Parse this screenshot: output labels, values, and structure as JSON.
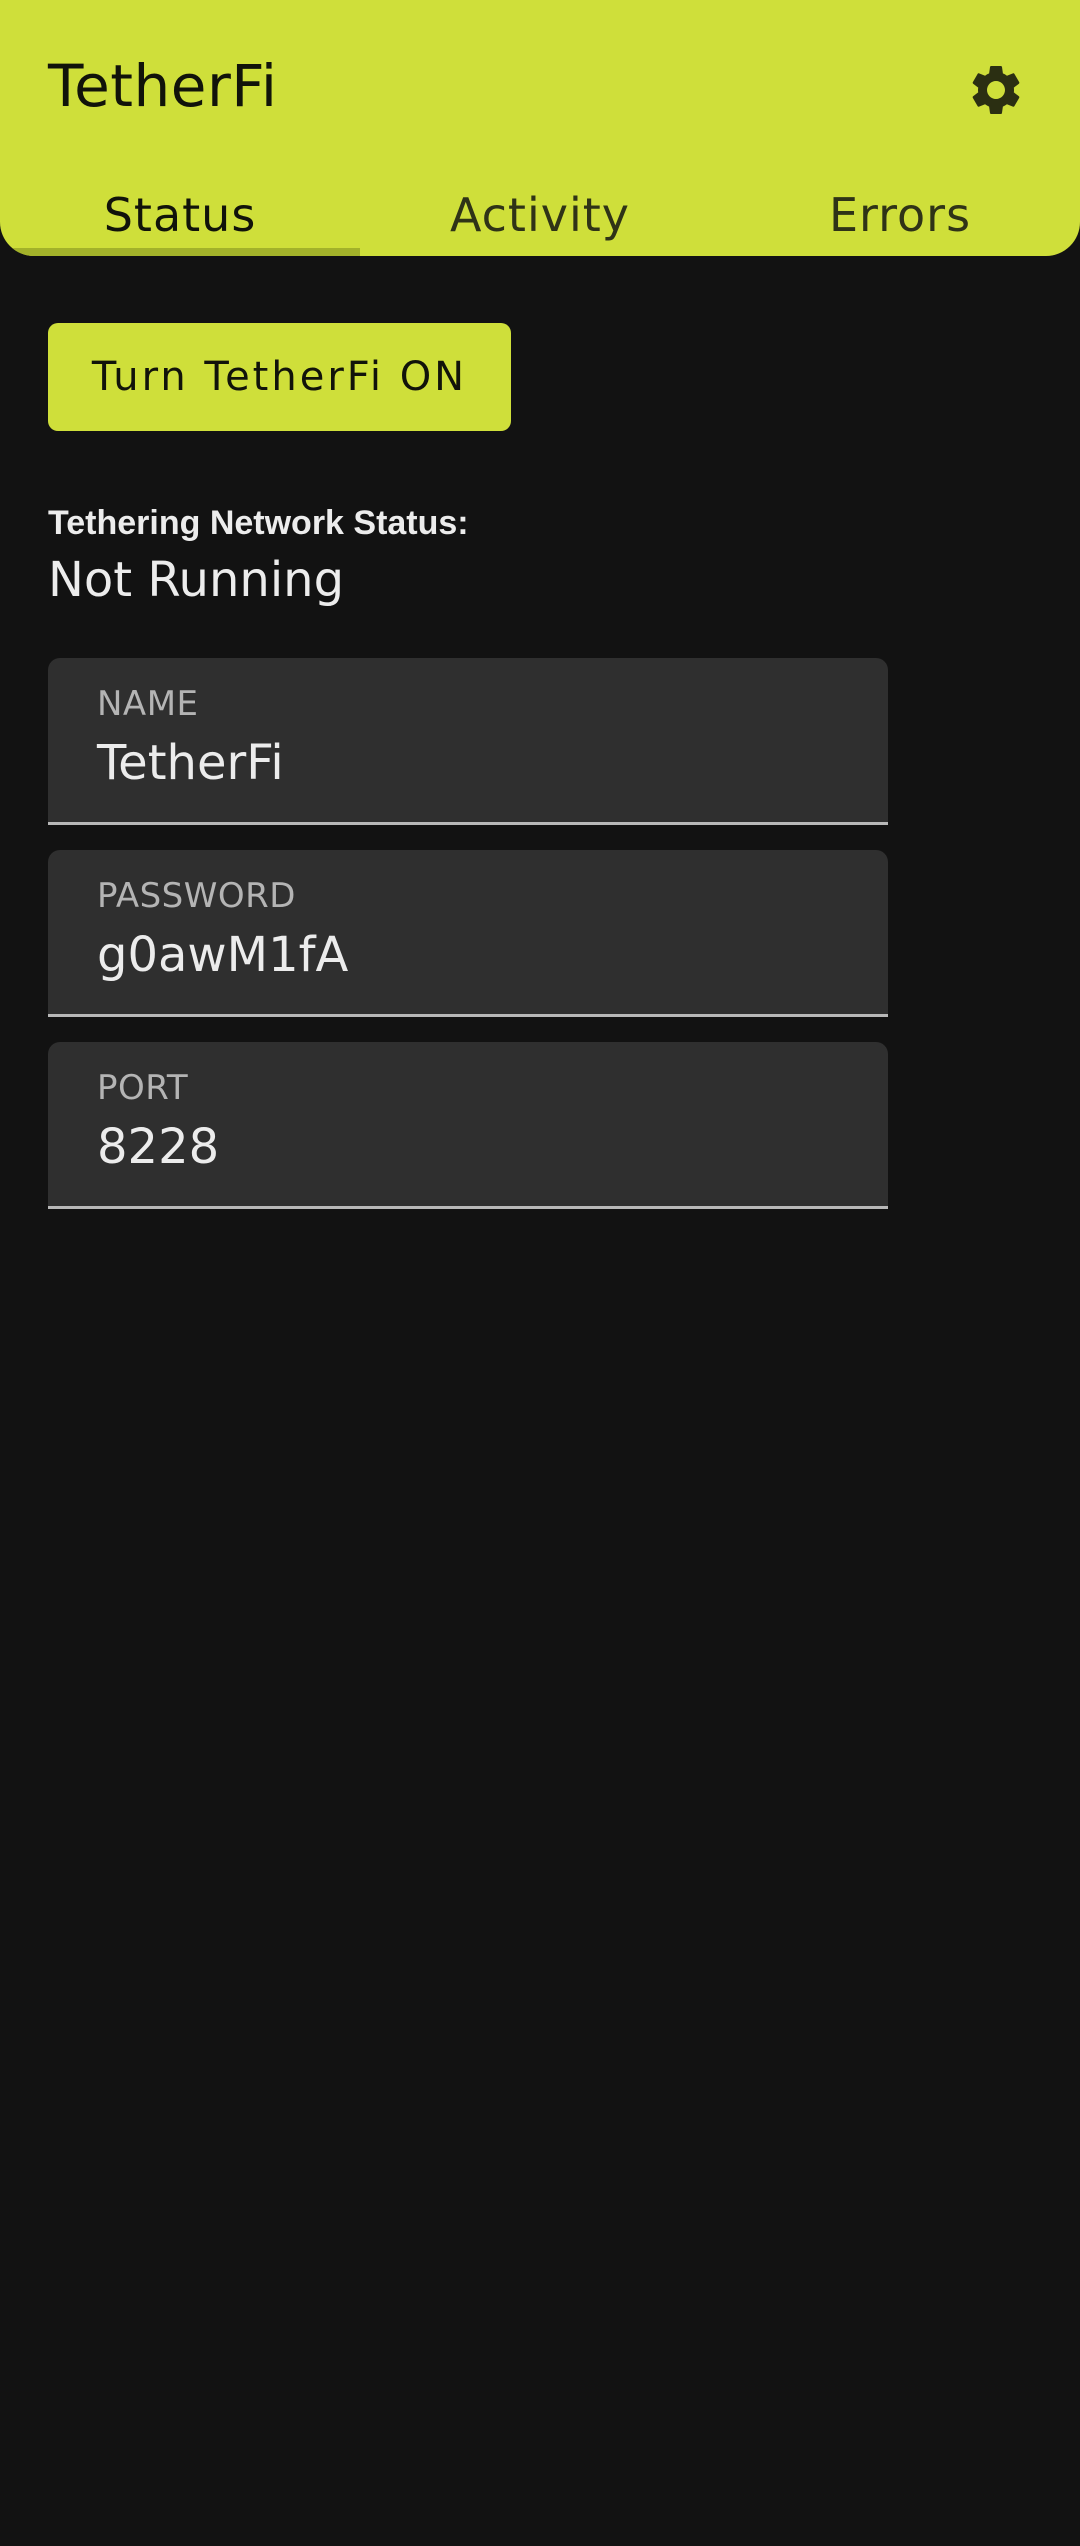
{
  "app": {
    "title": "TetherFi",
    "settings_icon": "gear-icon",
    "accent_color": "#cfdf3a"
  },
  "tabs": [
    {
      "label": "Status",
      "active": true
    },
    {
      "label": "Activity",
      "active": false
    },
    {
      "label": "Errors",
      "active": false
    }
  ],
  "main": {
    "toggle_button_label": "Turn TetherFi ON",
    "status_label": "Tethering Network Status:",
    "status_value": "Not Running",
    "fields": {
      "name": {
        "label": "NAME",
        "value": "TetherFi"
      },
      "password": {
        "label": "PASSWORD",
        "value": "g0awM1fA"
      },
      "port": {
        "label": "PORT",
        "value": "8228"
      }
    }
  }
}
